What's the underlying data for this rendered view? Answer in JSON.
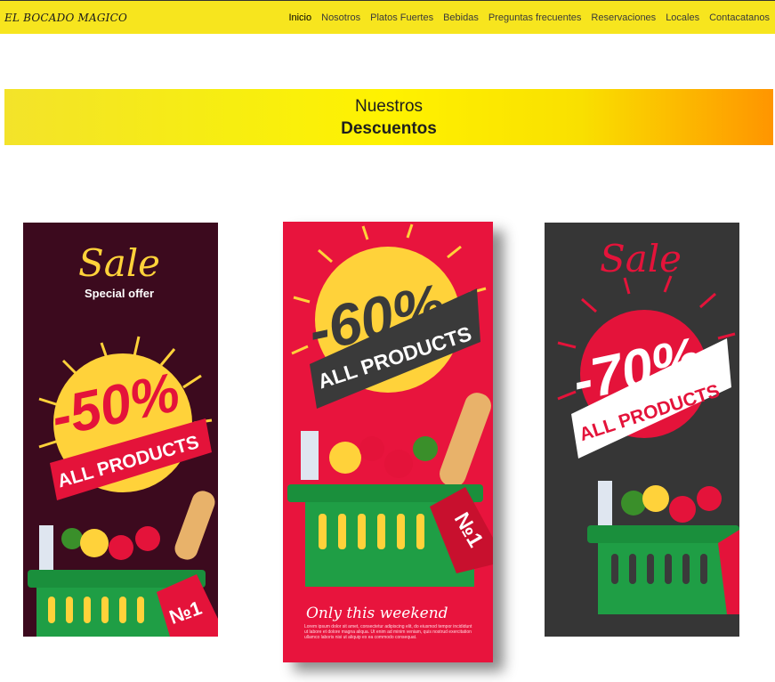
{
  "brand": "EL BOCADO MAGICO",
  "nav": [
    {
      "label": "Inicio",
      "active": true
    },
    {
      "label": "Nosotros"
    },
    {
      "label": "Platos Fuertes"
    },
    {
      "label": "Bebidas"
    },
    {
      "label": "Preguntas frecuentes"
    },
    {
      "label": "Reservaciones"
    },
    {
      "label": "Locales"
    },
    {
      "label": "Contacatanos"
    }
  ],
  "banner": {
    "line1": "Nuestros",
    "line2": "Descuentos"
  },
  "promos": [
    {
      "sale": "Sale",
      "subtitle": "Special offer",
      "discount": "-50%",
      "ribbon": "ALL PRODUCTS",
      "tag": "№1",
      "bg": "#3c0a1e",
      "sun": "#ffd23a",
      "ribbonColor": "#e4133a"
    },
    {
      "discount": "-60%",
      "ribbon": "ALL PRODUCTS",
      "tag": "№1",
      "footer": "Only this weekend",
      "fine": "Lorem ipsum dolor sit amet, consectetur adipiscing elit, do eiusmod tempor incididunt ut labore et dolore magna aliqua. Ut enim ad minim veniam, quis nostrud exercitation ullamco laboris nisi ut aliquip ex ea commodo consequat.",
      "bg": "#e8143d",
      "sun": "#ffd23a",
      "ribbonColor": "#3a3a3a"
    },
    {
      "sale": "Sale",
      "discount": "-70%",
      "ribbon": "ALL PRODUCTS",
      "bg": "#363636",
      "sun": "#e4133a",
      "ribbonColor": "#ffffff"
    }
  ]
}
